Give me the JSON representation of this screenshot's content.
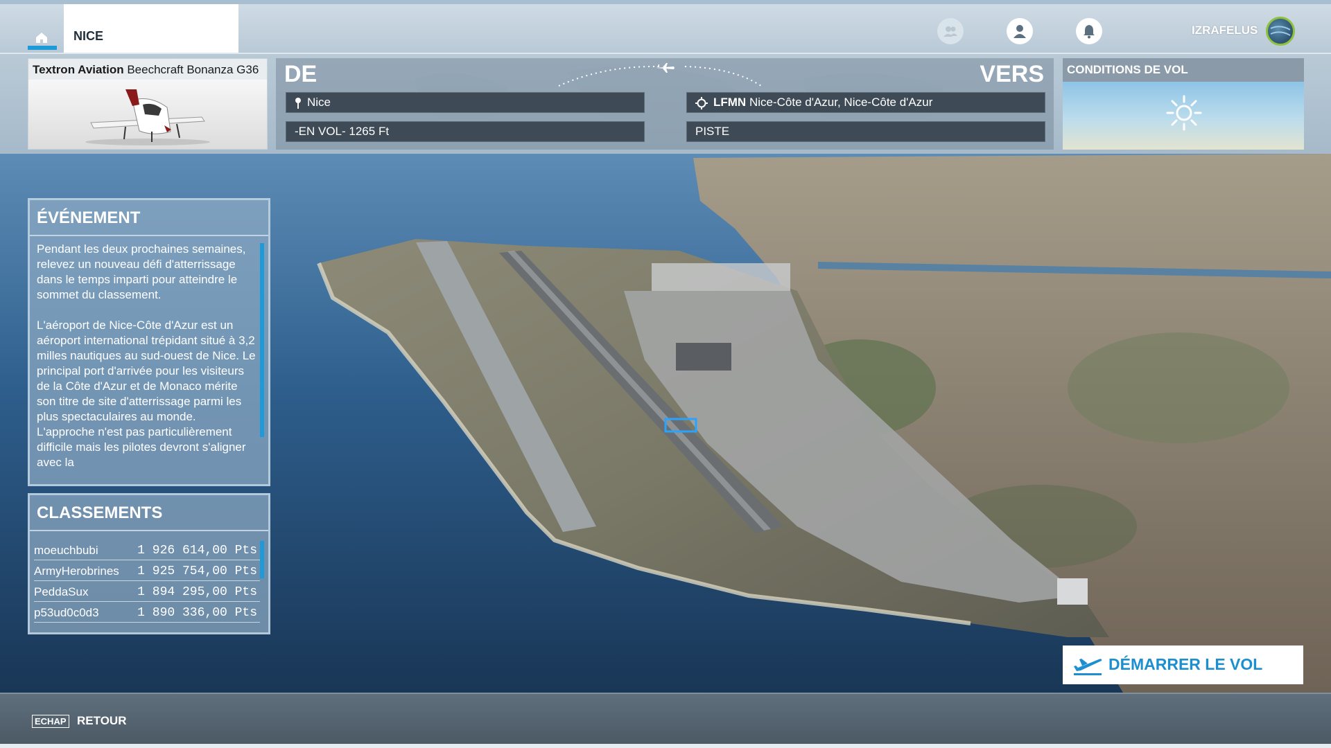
{
  "topbar": {
    "home_tab_label": "",
    "active_tab_label": "NICE",
    "username": "IZRAFELUS"
  },
  "aircraft": {
    "brand": "Textron Aviation",
    "model": "Beechcraft Bonanza G36"
  },
  "route": {
    "from_heading": "DE",
    "to_heading": "VERS",
    "departure": "Nice",
    "altitude": "-EN VOL- 1265 Ft",
    "arrival_code": "LFMN",
    "arrival_name": "Nice-Côte d'Azur, Nice-Côte d'Azur",
    "runway": "PISTE"
  },
  "conditions": {
    "title": "CONDITIONS DE VOL",
    "weather_icon": "sun-icon"
  },
  "event": {
    "title": "ÉVÉNEMENT",
    "paragraphs": [
      "Pendant les deux prochaines semaines, relevez un nouveau défi d'atterrissage dans le temps imparti pour atteindre le sommet du classement.",
      "L'aéroport de Nice-Côte d'Azur est un aéroport international trépidant situé à 3,2 milles nautiques au sud-ouest de Nice. Le principal port d'arrivée pour les visiteurs de la Côte d'Azur et de Monaco mérite son titre de site d'atterrissage parmi les plus spectaculaires au monde. L'approche n'est pas particulièrement difficile mais les pilotes devront s'aligner avec la"
    ]
  },
  "ranking": {
    "title": "CLASSEMENTS",
    "rows": [
      {
        "name": "moeuchbubi",
        "score": "1 926 614,00 Pts"
      },
      {
        "name": "ArmyHerobrines",
        "score": "1 925 754,00 Pts"
      },
      {
        "name": "PeddaSux",
        "score": "1 894 295,00 Pts"
      },
      {
        "name": "p53ud0c0d3",
        "score": "1 890 336,00 Pts"
      }
    ]
  },
  "actions": {
    "start_label": "DÉMARRER LE VOL",
    "back_key": "ECHAP",
    "back_label": "RETOUR"
  },
  "colors": {
    "accent": "#1e9ad8",
    "button_text": "#1b8fd0",
    "field_bg": "#3e4a55"
  }
}
